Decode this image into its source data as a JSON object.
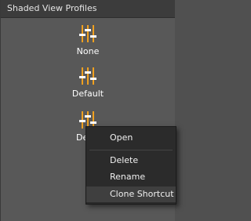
{
  "panel": {
    "title": "Shaded View Profiles"
  },
  "profiles": [
    {
      "label": "None",
      "icon": "sliders-icon"
    },
    {
      "label": "Default",
      "icon": "sliders-icon"
    },
    {
      "label": "De",
      "icon": "sliders-icon"
    }
  ],
  "context_menu": {
    "items": [
      {
        "label": "Open"
      },
      {
        "label": "Delete"
      },
      {
        "label": "Rename"
      },
      {
        "label": "Clone Shortcut"
      }
    ]
  },
  "colors": {
    "icon_accent": "#f0a020",
    "title_bar": "#3c3c3c",
    "panel_bg": "#585858",
    "menu_bg": "#2b2b2b"
  }
}
